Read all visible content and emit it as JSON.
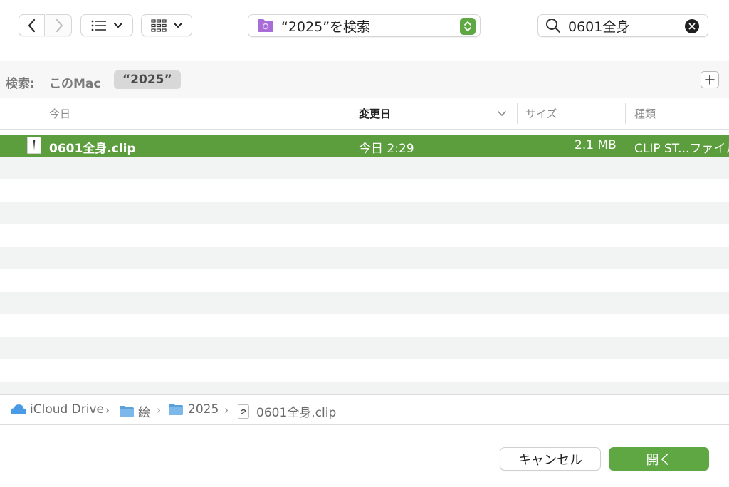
{
  "toolbar": {
    "location_label": "“2025”を検索",
    "search_value": "0601全身"
  },
  "scope": {
    "label": "検索:",
    "this_mac": "このMac",
    "folder": "“2025”"
  },
  "columns": {
    "name": "今日",
    "date": "変更日",
    "size": "サイズ",
    "kind": "種類"
  },
  "rows": [
    {
      "name": "0601全身.clip",
      "date": "今日 2:29",
      "size": "2.1 MB",
      "kind": "CLIP ST...ファイル",
      "selected": true
    }
  ],
  "pathbar": {
    "items": [
      "iCloud Drive",
      "絵",
      "2025",
      "0601全身.clip"
    ]
  },
  "buttons": {
    "cancel": "キャンセル",
    "open": "開く"
  },
  "colors": {
    "accent": "#5ea743",
    "selection": "#5c9e3e",
    "folder": "#5aa0db",
    "search_folder": "#a86dd6"
  },
  "icons": [
    "chevron-left-icon",
    "chevron-right-icon",
    "list-view-icon",
    "grid-view-icon",
    "search-folder-icon",
    "stepper-icon",
    "search-icon",
    "clear-icon",
    "plus-icon",
    "chevron-down-icon",
    "file-icon",
    "icloud-icon",
    "folder-icon"
  ]
}
